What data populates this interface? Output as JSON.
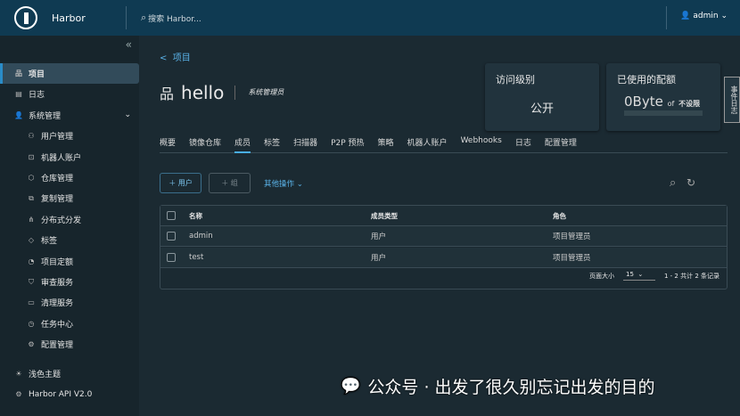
{
  "header": {
    "brand": "Harbor",
    "search_placeholder": "搜索 Harbor...",
    "user": "admin"
  },
  "sidebar": {
    "items": [
      {
        "label": "项目",
        "icon": "projects-icon",
        "active": true
      },
      {
        "label": "日志",
        "icon": "logs-icon"
      },
      {
        "label": "系统管理",
        "icon": "admin-icon"
      },
      {
        "label": "用户管理",
        "icon": "users-icon",
        "sub": true
      },
      {
        "label": "机器人账户",
        "icon": "robot-icon",
        "sub": true
      },
      {
        "label": "仓库管理",
        "icon": "registry-icon",
        "sub": true
      },
      {
        "label": "复制管理",
        "icon": "replication-icon",
        "sub": true
      },
      {
        "label": "分布式分发",
        "icon": "distribution-icon",
        "sub": true
      },
      {
        "label": "标签",
        "icon": "tag-icon",
        "sub": true
      },
      {
        "label": "项目定额",
        "icon": "quota-icon",
        "sub": true
      },
      {
        "label": "审查服务",
        "icon": "shield-icon",
        "sub": true
      },
      {
        "label": "清理服务",
        "icon": "trash-icon",
        "sub": true
      },
      {
        "label": "任务中心",
        "icon": "clock-icon",
        "sub": true
      },
      {
        "label": "配置管理",
        "icon": "gear-icon",
        "sub": true
      }
    ],
    "theme": "浅色主题",
    "api": "Harbor API V2.0"
  },
  "main": {
    "back": "项目",
    "title": "hello",
    "role": "系统管理员",
    "access": {
      "label": "访问级别",
      "value": "公开"
    },
    "quota": {
      "label": "已使用的配额",
      "used": "0Byte",
      "of": "of",
      "limit": "不设限",
      "fraction": 0
    },
    "tabs": [
      "概要",
      "镜像仓库",
      "成员",
      "标签",
      "扫描器",
      "P2P 预热",
      "策略",
      "机器人账户",
      "Webhooks",
      "日志",
      "配置管理"
    ],
    "active_tab": "成员",
    "add_user": "用户",
    "add_group": "组",
    "more": "其他操作",
    "table": {
      "headers": [
        "名称",
        "成员类型",
        "角色"
      ],
      "rows": [
        [
          "admin",
          "用户",
          "项目管理员"
        ],
        [
          "test",
          "用户",
          "项目管理员"
        ]
      ],
      "page_size_label": "页面大小",
      "page_size": "15",
      "summary": "1 - 2 共计 2 条记录"
    }
  },
  "event_log": "事件日志",
  "watermark": "公众号 · 出发了很久别忘记出发的目的"
}
